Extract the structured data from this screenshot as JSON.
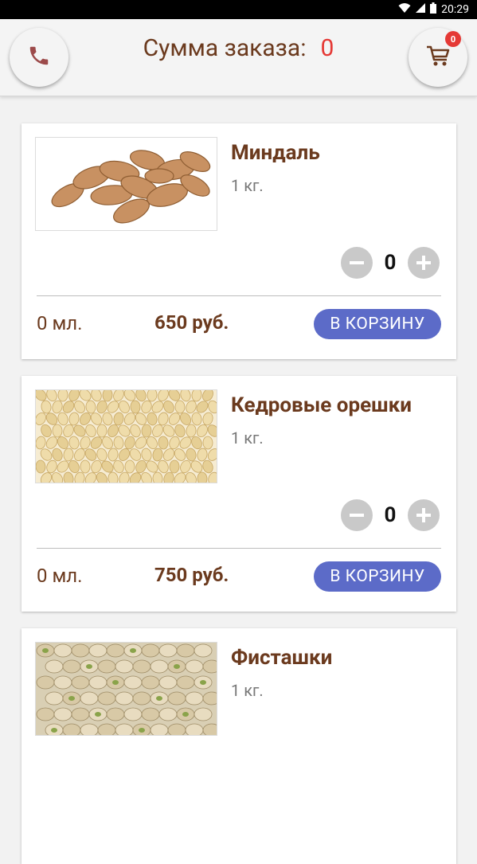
{
  "status_bar": {
    "time": "20:29",
    "icons": [
      "wifi-icon",
      "signal-icon",
      "battery-icon"
    ]
  },
  "header": {
    "order_sum_label": "Сумма заказа:",
    "order_sum_value": "0",
    "cart_count": "0",
    "icons": [
      "phone-icon",
      "cart-icon"
    ]
  },
  "products": [
    {
      "title": "Миндаль",
      "weight": "1 кг.",
      "quantity": "0",
      "ml": "0 мл.",
      "price": "650 руб.",
      "add_label": "В КОРЗИНУ"
    },
    {
      "title": "Кедровые орешки",
      "weight": "1 кг.",
      "quantity": "0",
      "ml": "0 мл.",
      "price": "750 руб.",
      "add_label": "В КОРЗИНУ"
    },
    {
      "title": "Фисташки",
      "weight": "1 кг."
    }
  ],
  "colors": {
    "brown": "#6b3a1e",
    "accent_red": "#e53935",
    "button_blue": "#5c6bc8",
    "stepper_gray": "#c9c9c9"
  }
}
